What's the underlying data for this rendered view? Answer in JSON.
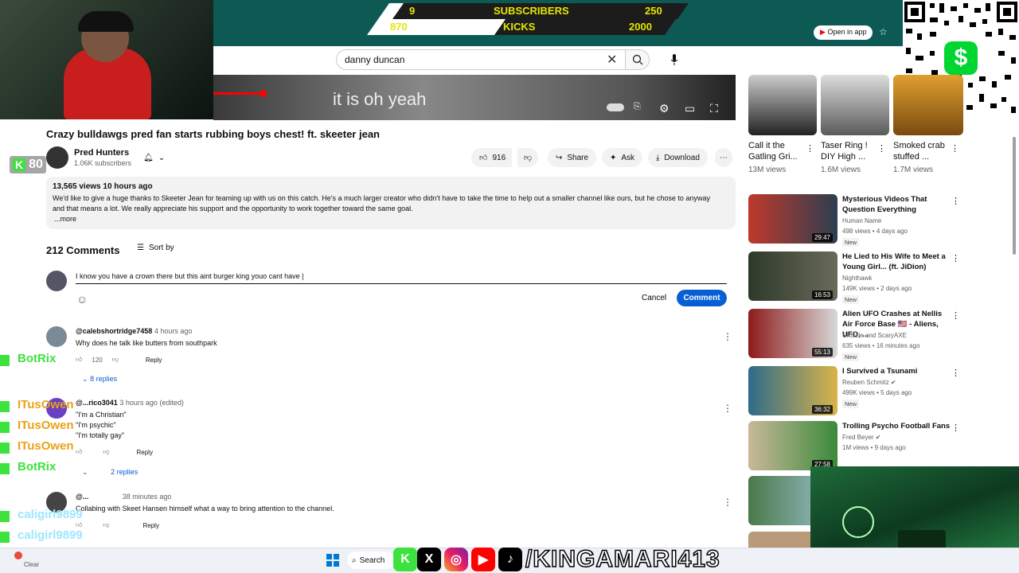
{
  "overlay": {
    "subs_current": "9",
    "subs_label": "SUBSCRIBERS",
    "subs_goal": "250",
    "kicks_current": "870",
    "kicks_label": "KICKS",
    "kicks_goal": "2000",
    "kick_viewers": "80",
    "social_handle": "/KINGAMARI413",
    "colors": {
      "goal_bar": "#0d5a55",
      "goal_text": "#e6e600",
      "kick_green": "#3ee23e"
    }
  },
  "header": {
    "search_value": "danny duncan",
    "open_in_app": "Open in app"
  },
  "video": {
    "caption": "it is oh yeah",
    "title": "Crazy bulldawgs pred fan starts rubbing boys chest! ft. skeeter jean",
    "channel": "Pred Hunters",
    "subscribers": "1.06K subscribers",
    "likes": "916",
    "share": "Share",
    "ask": "Ask",
    "download": "Download"
  },
  "description": {
    "stats": "13,565 views  10 hours ago",
    "text": "We'd like to give a huge thanks to Skeeter Jean for teaming up with us on this catch. He's a much larger creator who didn't have to take the time to help out a smaller channel like ours, but he chose to anyway and that means a lot. We really appreciate his support and the opportunity to work together toward the same goal.",
    "more": "...more"
  },
  "comments": {
    "count": "212 Comments",
    "sort": "Sort by",
    "draft": "I know you have a crown there but this aint burger king youo cant have |",
    "cancel": "Cancel",
    "submit": "Comment",
    "items": [
      {
        "handle": "@calebshortridge7458",
        "time": "4 hours ago",
        "text": "Why does he talk like butters from southpark",
        "likes": "120",
        "reply": "Reply",
        "replies": "8 replies"
      },
      {
        "handle": "@...rico3041",
        "time": "3 hours ago (edited)",
        "lines": [
          "\"I'm a Christian\"",
          "\"I'm psychic\"",
          "\"I'm totally gay\""
        ],
        "reply": "Reply",
        "replies": "2 replies"
      },
      {
        "handle": "@...",
        "time": "38 minutes ago",
        "text": "Collabing with Skeet Hansen himself what a way to bring attention to the channel.",
        "reply": "Reply"
      }
    ]
  },
  "chat": [
    {
      "name": "BotRix"
    },
    {
      "name": "ITusOwen"
    },
    {
      "name": "ITusOwen"
    },
    {
      "name": "ITusOwen"
    },
    {
      "name": "BotRix"
    },
    {
      "name": "caligirl9899"
    },
    {
      "name": "caligirl9899"
    }
  ],
  "shorts": [
    {
      "title": "Call it the Gatling Gri...",
      "views": "13M views"
    },
    {
      "title": "Taser Ring ! DIY High ...",
      "views": "1.6M views"
    },
    {
      "title": "Smoked crab stuffed ...",
      "views": "1.7M views"
    }
  ],
  "recommended": [
    {
      "title": "Mysterious Videos That Question Everything",
      "channel": "Human Name",
      "meta": "498 views • 4 days ago",
      "badge": "New",
      "duration": "29:47"
    },
    {
      "title": "He Lied to His Wife to Meet a Young Girl... (ft. JiDion)",
      "channel": "Nighthawk",
      "meta": "149K views • 2 days ago",
      "badge": "New",
      "duration": "16:53"
    },
    {
      "title": "Alien UFO Crashes at Nellis Air Force Base 🇺🇸 - Aliens, UFO, ...",
      "channel": "SKizzle and ScaryAXE",
      "meta": "635 views • 16 minutes ago",
      "badge": "New",
      "duration": "55:13"
    },
    {
      "title": "I Survived a Tsunami",
      "channel": "Reuben Schmitz ✔",
      "meta": "499K views • 5 days ago",
      "badge": "New",
      "duration": "36:32"
    },
    {
      "title": "Trolling Psycho Football Fans",
      "channel": "Fred Beyer ✔",
      "meta": "1M views • 9 days ago",
      "badge": "",
      "duration": "27:58"
    }
  ],
  "taskbar": {
    "search": "Search",
    "clear": "Clear"
  }
}
